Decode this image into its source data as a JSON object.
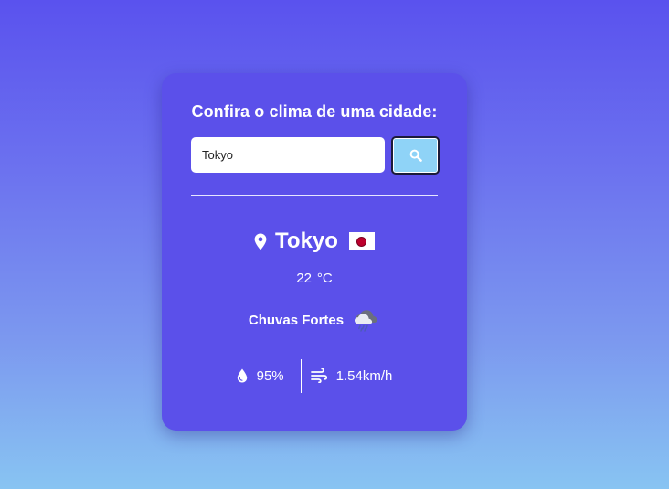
{
  "card": {
    "title": "Confira o clima de uma cidade:"
  },
  "search": {
    "value": "Tokyo",
    "placeholder": "",
    "button_icon": "search-icon"
  },
  "weather": {
    "location_icon": "map-pin-icon",
    "city": "Tokyo",
    "country_flag": "japan-flag",
    "temperature": "22",
    "temperature_unit": "°C",
    "description": "Chuvas Fortes",
    "condition_icon": "heavy-rain-cloud-icon",
    "humidity_icon": "water-drop-icon",
    "humidity": "95%",
    "wind_icon": "wind-icon",
    "wind": "1.54km/h"
  },
  "colors": {
    "card_background": "#5b50ea",
    "search_button": "#8fd3f7",
    "flag_red": "#bc002d",
    "text": "#ffffff"
  }
}
